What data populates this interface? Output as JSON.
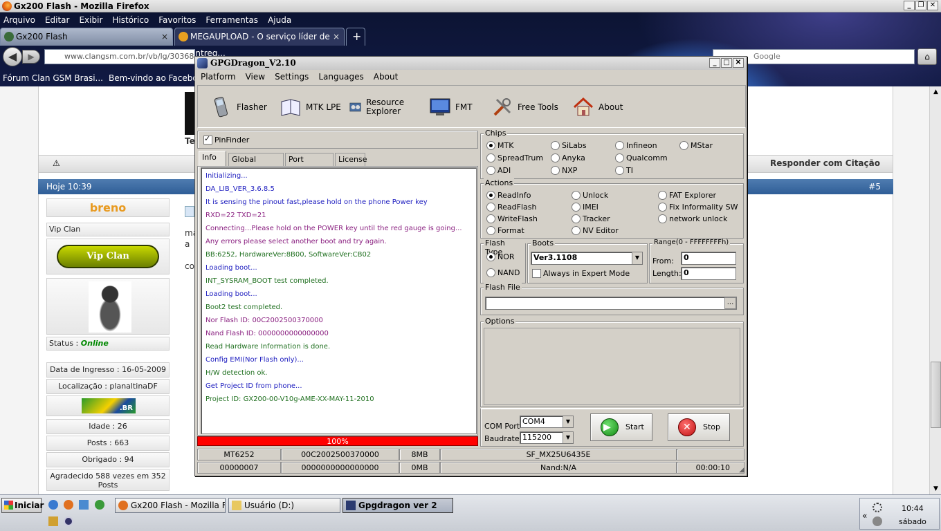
{
  "browser": {
    "title": "Gx200 Flash - Mozilla Firefox",
    "menu": [
      "Arquivo",
      "Editar",
      "Exibir",
      "Histórico",
      "Favoritos",
      "Ferramentas",
      "Ajuda"
    ],
    "tabs": [
      {
        "label": "Gx200 Flash",
        "close": "×"
      },
      {
        "label": "MEGAUPLOAD - O serviço líder de entreg...",
        "close": "×"
      }
    ],
    "new_tab": "+",
    "url": "www.clangsm.com.br/vb/lg/30368-gx",
    "search_placeholder": "Google",
    "bookmarks": [
      "Fórum Clan GSM Brasi...",
      "Bem-vindo ao Facebo..."
    ]
  },
  "page": {
    "postbar_reply": "Responder com Citação",
    "post_time": "Hoje 10:39",
    "post_num": "#5",
    "user": {
      "name": "breno",
      "rank": "Vip Clan",
      "badge": "Vip Clan",
      "status_label": "Status :",
      "status": "Online",
      "joined": "Data de Ingresso : 16-05-2009",
      "location": "Localização : planaltinaDF",
      "flag_text": ".BR",
      "age": "Idade : 26",
      "posts": "Posts : 663",
      "thanks": "Obrigado : 94",
      "thanked": "Agradecido 588 vezes em 352 Posts"
    },
    "body_fragments": [
      "Te",
      "ma",
      "a",
      "co"
    ]
  },
  "gpg": {
    "title": "GPGDragon_V2.10",
    "menu": [
      "Platform",
      "View",
      "Settings",
      "Languages",
      "About"
    ],
    "tools": [
      {
        "label": "Flasher",
        "icon": "phone-icon"
      },
      {
        "label": "MTK LPE",
        "icon": "book-icon"
      },
      {
        "label": "Resource Explorer",
        "icon": "film-icon"
      },
      {
        "label": "FMT",
        "icon": "monitor-icon"
      },
      {
        "label": "Free Tools",
        "icon": "tools-icon"
      },
      {
        "label": "About",
        "icon": "house-icon"
      }
    ],
    "pinfinder": "PinFinder",
    "tabs": [
      "Info",
      "Global Settings",
      "Port Monitor",
      "License"
    ],
    "log": [
      {
        "text": "Initializing...",
        "color": "#2020c0"
      },
      {
        "text": "DA_LIB_VER_3.6.8.5",
        "color": "#2020c0"
      },
      {
        "text": "It is sensing the pinout fast,please hold on the phone Power key",
        "color": "#2020c0"
      },
      {
        "text": "RXD=22  TXD=21",
        "color": "#8a2080"
      },
      {
        "text": "Connecting...Please hold on the POWER key until the red gauge is going...",
        "color": "#8a2080"
      },
      {
        "text": "Any errors please select another boot and try again.",
        "color": "#8a2080"
      },
      {
        "text": "BB:6252,    HardwareVer:8B00,    SoftwareVer:CB02",
        "color": "#207020"
      },
      {
        "text": "Loading boot...",
        "color": "#2020c0"
      },
      {
        "text": "INT_SYSRAM_BOOT test completed.",
        "color": "#207020"
      },
      {
        "text": "Loading boot...",
        "color": "#2020c0"
      },
      {
        "text": "Boot2 test completed.",
        "color": "#207020"
      },
      {
        "text": "Nor Flash ID: 00C2002500370000",
        "color": "#8a2080"
      },
      {
        "text": "Nand Flash ID: 0000000000000000",
        "color": "#8a2080"
      },
      {
        "text": "Read Hardware Information is done.",
        "color": "#207020"
      },
      {
        "text": "Config EMI(Nor Flash only)...",
        "color": "#2020c0"
      },
      {
        "text": "H/W detection ok.",
        "color": "#207020"
      },
      {
        "text": "Get Project ID from phone...",
        "color": "#2020c0"
      },
      {
        "text": "Project ID: GX200-00-V10g-AME-XX-MAY-11-2010",
        "color": "#207020"
      }
    ],
    "progress": "100%",
    "chips": {
      "label": "Chips",
      "items": [
        "MTK",
        "SiLabs",
        "Infineon",
        "MStar",
        "SpreadTrum",
        "Anyka",
        "Qualcomm",
        "ADI",
        "NXP",
        "TI"
      ],
      "selected": "MTK"
    },
    "actions": {
      "label": "Actions",
      "items": [
        "ReadInfo",
        "Unlock",
        "FAT Explorer",
        "ReadFlash",
        "IMEI",
        "Fix Informality SW",
        "WriteFlash",
        "Tracker",
        "network unlock",
        "Format",
        "NV Editor"
      ],
      "selected": "ReadInfo"
    },
    "flash_type": {
      "label": "Flash Type",
      "nor": "NOR",
      "nand": "NAND",
      "selected": "NOR"
    },
    "boots": {
      "label": "Boots",
      "value": "Ver3.1108",
      "expert": "Always in Expert Mode"
    },
    "range": {
      "label": "Range(0 - FFFFFFFFh)",
      "from_label": "From:",
      "from": "0",
      "length_label": "Length:",
      "length": "0"
    },
    "flash_file": {
      "label": "Flash File",
      "value": "",
      "browse": "..."
    },
    "options": {
      "label": "Options"
    },
    "com": {
      "port_label": "COM Port",
      "port": "COM4",
      "baud_label": "Baudrate",
      "baud": "115200"
    },
    "start": "Start",
    "stop": "Stop",
    "status": [
      [
        "MT6252",
        "00C2002500370000",
        "8MB",
        "SF_MX25U6435E",
        ""
      ],
      [
        "00000007",
        "0000000000000000",
        "0MB",
        "Nand:N/A",
        "00:00:10"
      ]
    ]
  },
  "taskbar": {
    "start": "Iniciar",
    "items": [
      "Gx200 Flash - Mozilla Fire...",
      "Usuário (D:)",
      "Gpgdragon ver 2"
    ],
    "time": "10:44",
    "day": "sábado",
    "chevron": "«"
  }
}
